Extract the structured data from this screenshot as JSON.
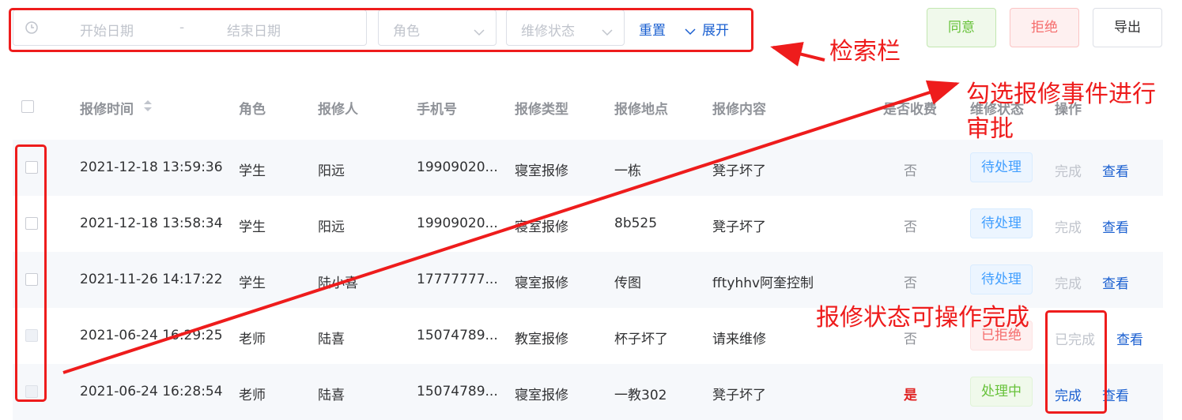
{
  "search": {
    "start_placeholder": "开始日期",
    "separator": "-",
    "end_placeholder": "结束日期",
    "role_placeholder": "角色",
    "status_placeholder": "维修状态",
    "reset_label": "重置",
    "expand_label": "展开"
  },
  "actions": {
    "agree_label": "同意",
    "reject_label": "拒绝",
    "export_label": "导出"
  },
  "table": {
    "headers": {
      "time": "报修时间",
      "role": "角色",
      "reporter": "报修人",
      "phone": "手机号",
      "type": "报修类型",
      "location": "报修地点",
      "content": "报修内容",
      "charged": "是否收费",
      "status": "维修状态",
      "operation": "操作"
    },
    "rows": [
      {
        "time": "2021-12-18 13:59:36",
        "role": "学生",
        "reporter": "阳远",
        "phone": "19909020...",
        "type": "寝室报修",
        "location": "一栋",
        "content": "凳子坏了",
        "charged": "否",
        "status": "待处理",
        "op_action": "完成",
        "op_view": "查看"
      },
      {
        "time": "2021-12-18 13:58:34",
        "role": "学生",
        "reporter": "阳远",
        "phone": "19909020...",
        "type": "寝室报修",
        "location": "8b525",
        "content": "凳子坏了",
        "charged": "否",
        "status": "待处理",
        "op_action": "完成",
        "op_view": "查看"
      },
      {
        "time": "2021-11-26 14:17:22",
        "role": "学生",
        "reporter": "陆小喜",
        "phone": "17777777...",
        "type": "寝室报修",
        "location": "传图",
        "content": "fftyhhv阿奎控制",
        "charged": "否",
        "status": "待处理",
        "op_action": "完成",
        "op_view": "查看"
      },
      {
        "time": "2021-06-24 16:29:25",
        "role": "老师",
        "reporter": "陆喜",
        "phone": "15074789...",
        "type": "教室报修",
        "location": "杯子坏了",
        "content": "请来维修",
        "charged": "否",
        "status": "已拒绝",
        "op_action": "已完成",
        "op_view": "查看"
      },
      {
        "time": "2021-06-24 16:28:54",
        "role": "老师",
        "reporter": "陆喜",
        "phone": "15074789...",
        "type": "寝室报修",
        "location": "一教302",
        "content": "凳子坏了",
        "charged": "是",
        "status": "处理中",
        "op_action": "完成",
        "op_view": "查看"
      }
    ]
  },
  "annotations": {
    "search_bar": "检索栏",
    "select_tip_line1": "勾选报修事件进行",
    "select_tip_line2": "审批",
    "status_tip": "报修状态可操作完成"
  },
  "colors": {
    "annotation_red": "#ee1c1c",
    "link_blue": "#1a5fd0",
    "pending_blue": "#409eff",
    "rejected_red": "#f56c6c",
    "processing_green": "#67c23a"
  }
}
